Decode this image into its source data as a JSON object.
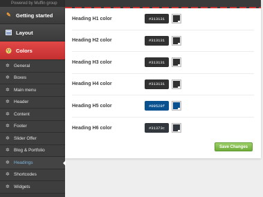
{
  "brand": "Powered by Muffin group",
  "sections": [
    {
      "label": "Getting started",
      "icon": "wand-icon"
    },
    {
      "label": "Layout",
      "icon": "layout-icon"
    },
    {
      "label": "Colors",
      "icon": "palette-icon"
    }
  ],
  "submenu": [
    {
      "label": "General"
    },
    {
      "label": "Boxes"
    },
    {
      "label": "Main menu"
    },
    {
      "label": "Header"
    },
    {
      "label": "Content"
    },
    {
      "label": "Footer"
    },
    {
      "label": "Slider Offer"
    },
    {
      "label": "Blog & Portfolio"
    },
    {
      "label": "Headings"
    },
    {
      "label": "Shortcodes"
    },
    {
      "label": "Widgets"
    }
  ],
  "colors": {
    "accent_red": "#d43b3b",
    "sidebar_bg": "#3a3a3a",
    "save_green": "#7ab648"
  },
  "headings": [
    {
      "label": "Heading H1 color",
      "value": "#313131"
    },
    {
      "label": "Heading H2 color",
      "value": "#313131"
    },
    {
      "label": "Heading H3 color",
      "value": "#313131"
    },
    {
      "label": "Heading H4 color",
      "value": "#313131"
    },
    {
      "label": "Heading H5 color",
      "value": "#09528f"
    },
    {
      "label": "Heading H6 color",
      "value": "#31373c"
    }
  ],
  "save_label": "Save Changes"
}
